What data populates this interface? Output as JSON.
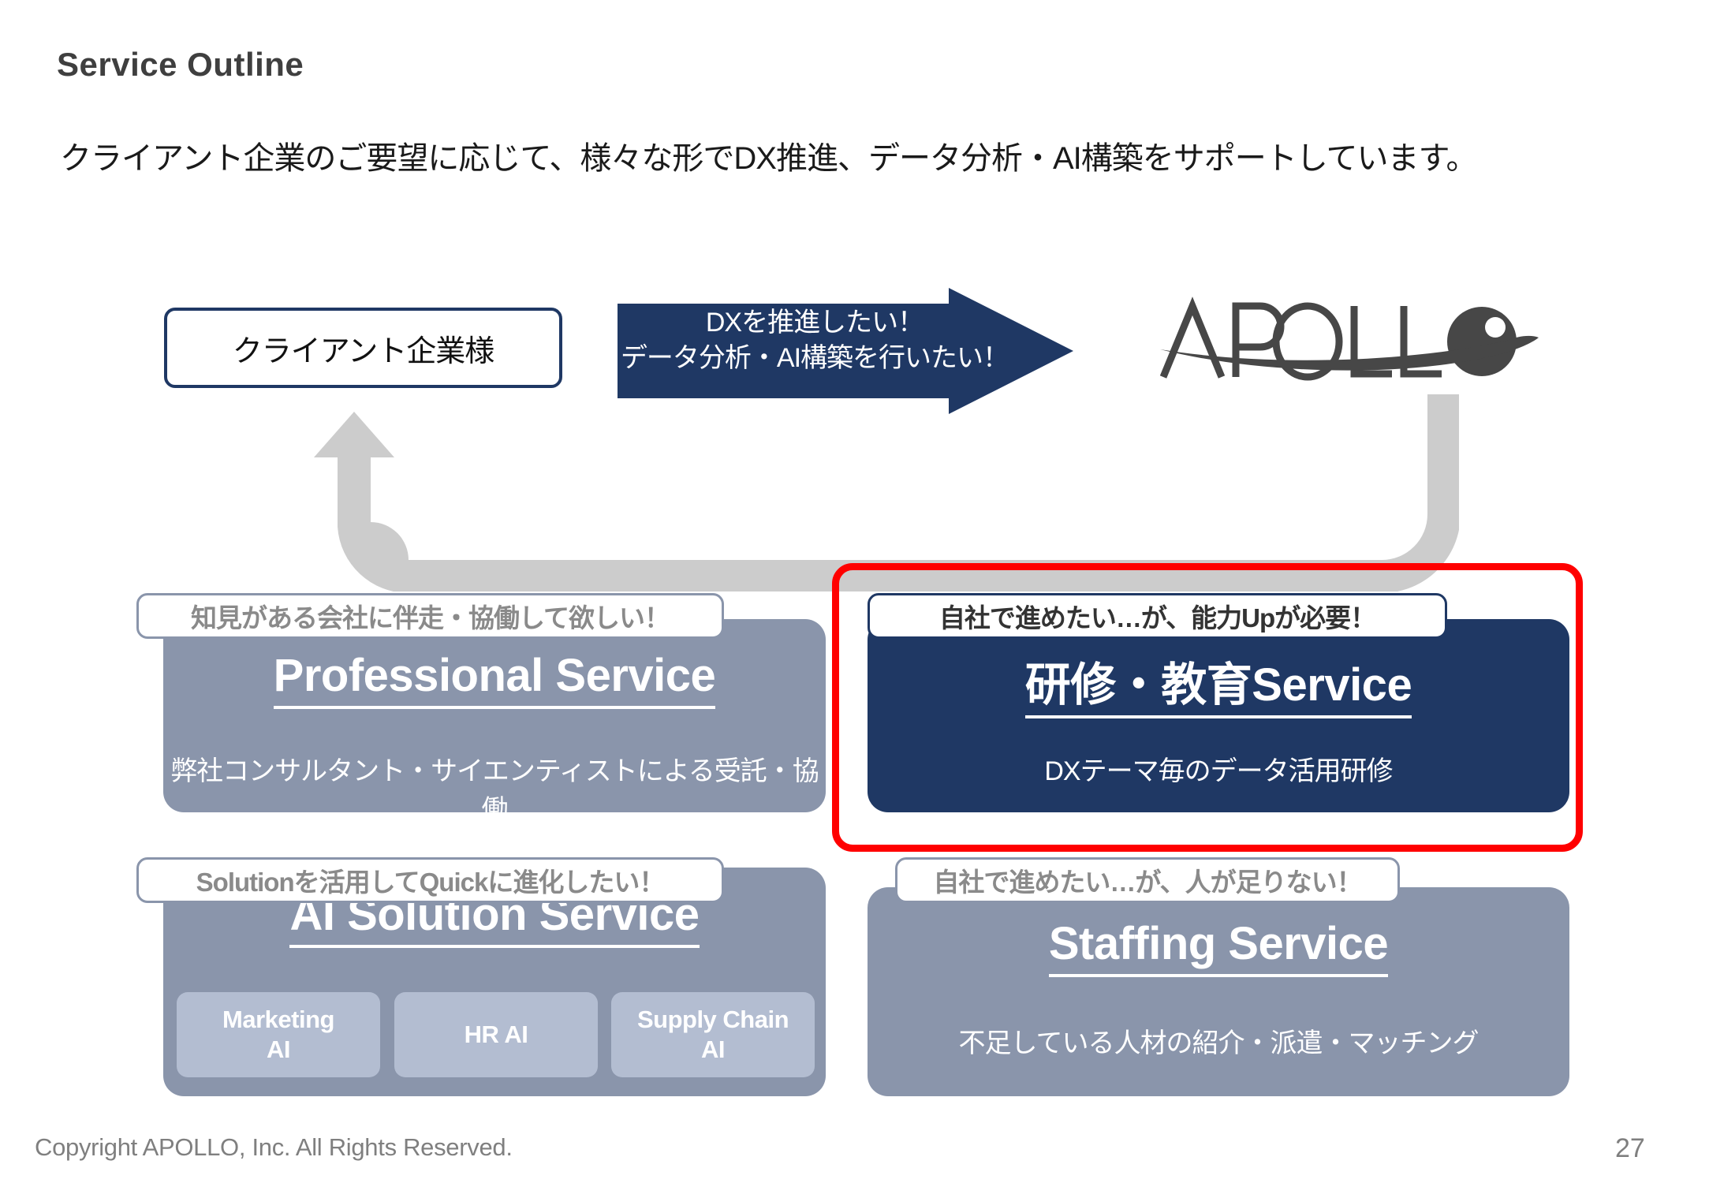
{
  "slide": {
    "title": "Service Outline",
    "lead": "クライアント企業のご要望に応じて、様々な形でDX推進、データ分析・AI構築をサポートしています。",
    "page_number": "27",
    "copyright": "Copyright APOLLO, Inc. All Rights Reserved."
  },
  "flow": {
    "client_box_label": "クライアント企業様",
    "request_arrow_line1": "DXを推進したい！",
    "request_arrow_line2": "データ分析・AI構築を行いたい！",
    "logo_text": "APOLLO"
  },
  "services": [
    {
      "id": "professional",
      "badge": "知見がある会社に伴走・協働して欲しい！",
      "title": "Professional Service",
      "subtitle": "弊社コンサルタント・サイエンティストによる受託・協働",
      "highlighted": "false"
    },
    {
      "id": "training",
      "badge": "自社で進めたい…が、能力Upが必要！",
      "title": "研修・教育Service",
      "subtitle": "DXテーマ毎のデータ活用研修",
      "highlighted": "true"
    },
    {
      "id": "ai-solution",
      "badge": "Solutionを活用してQuickに進化したい！",
      "title": "AI Solution Service",
      "subtitle": "",
      "highlighted": "false",
      "chips": [
        {
          "line1": "Marketing",
          "line2": "AI"
        },
        {
          "line1": "HR AI",
          "line2": ""
        },
        {
          "line1": "Supply Chain",
          "line2": "AI"
        }
      ]
    },
    {
      "id": "staffing",
      "badge": "自社で進めたい…が、人が足りない！",
      "title": "Staffing Service",
      "subtitle": "不足している人材の紹介・派遣・マッチング",
      "highlighted": "false"
    }
  ],
  "colors": {
    "navy": "#1f3864",
    "card_gray": "#8a95ab",
    "chip_gray": "#b3bdd1",
    "highlight_red": "#ff0000",
    "arrow_gray": "#cccccc",
    "badge_text_gray": "#8a8a8a",
    "footer_gray": "#7f7f7f"
  }
}
